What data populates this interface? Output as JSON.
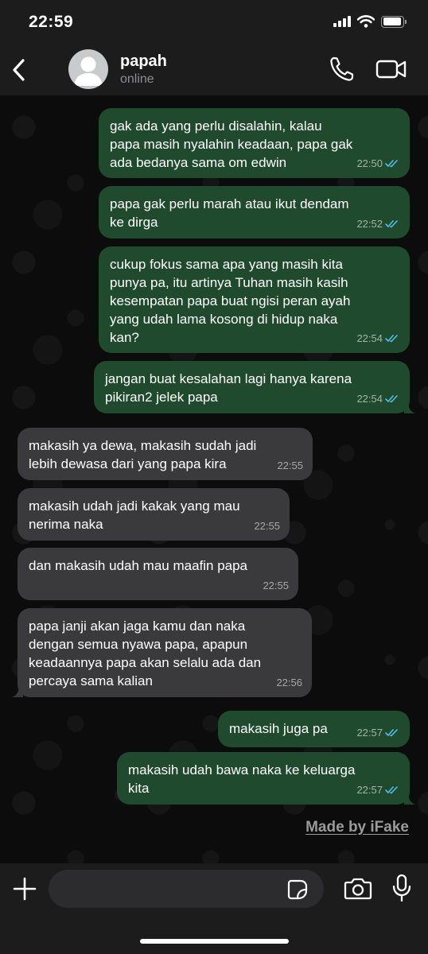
{
  "status_bar": {
    "time": "22:59",
    "battery_level": 0.92
  },
  "header": {
    "back_icon": "chevron-left-icon",
    "contact_name": "papah",
    "contact_status": "online",
    "call_icon": "phone-icon",
    "video_icon": "video-camera-icon"
  },
  "messages": [
    {
      "direction": "out",
      "text": "gak ada yang perlu disalahin, kalau\npapa masih nyalahin keadaan, papa gak\nada bedanya sama om edwin",
      "time": "22:50",
      "read": true
    },
    {
      "direction": "out",
      "text": "papa gak perlu marah atau ikut dendam\nke dirga",
      "time": "22:52",
      "read": true
    },
    {
      "direction": "out",
      "text": "cukup fokus sama apa yang masih kita\npunya pa, itu artinya Tuhan masih kasih\nkesempatan papa buat ngisi peran ayah\nyang udah lama kosong di hidup naka\nkan?",
      "time": "22:54",
      "read": true
    },
    {
      "direction": "out",
      "text": "jangan buat kesalahan lagi hanya karena\npikiran2 jelek papa",
      "time": "22:54",
      "read": true
    },
    {
      "direction": "in",
      "text": "makasih ya dewa, makasih sudah jadi\nlebih dewasa dari yang papa kira",
      "time": "22:55"
    },
    {
      "direction": "in",
      "text": "makasih udah jadi kakak yang mau\nnerima naka",
      "time": "22:55"
    },
    {
      "direction": "in",
      "text": "dan makasih udah mau maafin papa",
      "time": "22:55"
    },
    {
      "direction": "in",
      "text": "papa janji akan jaga kamu dan naka\ndengan semua nyawa papa, apapun\nkeadaannya papa akan selalu ada dan\npercaya sama kalian",
      "time": "22:56"
    },
    {
      "direction": "out",
      "text": "makasih juga pa",
      "time": "22:57",
      "read": true
    },
    {
      "direction": "out",
      "text": "makasih udah bawa naka ke keluarga\nkita",
      "time": "22:57",
      "read": true
    }
  ],
  "watermark": "Made by iFake",
  "composer": {
    "plus_icon": "plus-icon",
    "input_value": "",
    "sticker_icon": "sticker-icon",
    "camera_icon": "camera-icon",
    "mic_icon": "microphone-icon"
  },
  "colors": {
    "outgoing_bubble": "#1f4a2d",
    "incoming_bubble": "#3a3a3c",
    "read_ticks": "#53bdeb",
    "bars": "#1c1c1d"
  }
}
